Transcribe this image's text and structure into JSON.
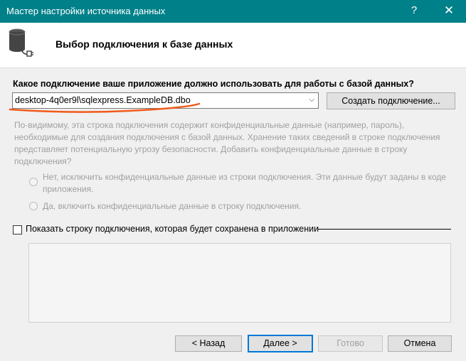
{
  "window": {
    "title": "Мастер настройки источника данных",
    "help_glyph": "?",
    "close_glyph": "✕"
  },
  "header": {
    "title": "Выбор подключения к базе данных",
    "icon": "database-plug-icon"
  },
  "connection": {
    "question": "Какое подключение ваше приложение должно использовать для работы с базой данных?",
    "selected": "desktop-4q0er9l\\sqlexpress.ExampleDB.dbo",
    "create_button": "Создать подключение..."
  },
  "sensitive": {
    "note": "По-видимому, эта строка подключения содержит конфиденциальные данные (например, пароль), необходимые для создания подключения с базой данных. Хранение таких сведений в строке подключения представляет потенциальную угрозу безопасности. Добавить конфиденциальные данные в строку подключения?",
    "option_no": "Нет, исключить конфиденциальные данные из строки подключения. Эти данные будут заданы в коде приложения.",
    "option_yes": "Да, включить конфиденциальные данные в строку подключения."
  },
  "show_string": {
    "label": "Показать строку подключения, которая будет сохранена в приложении",
    "checked": false
  },
  "footer": {
    "back": "< Назад",
    "next": "Далее >",
    "finish": "Готово",
    "cancel": "Отмена"
  },
  "colors": {
    "titlebar": "#00818a",
    "annotation_underline": "#f05a1a",
    "focus_border": "#0078d7"
  }
}
